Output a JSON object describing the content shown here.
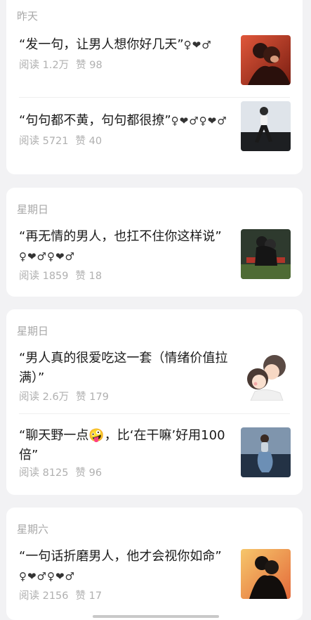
{
  "groups": [
    {
      "date": "昨天",
      "articles": [
        {
          "title": "“发一句，让男人想你好几天”",
          "suffix": "♀❤♂",
          "read": "阅读 1.2万",
          "like": "赞 98",
          "thumb": "couple-red-icon"
        },
        {
          "title": "“句句都不黄，句句都很撩”",
          "suffix": "♀❤♂♀❤♂",
          "read": "阅读 5721",
          "like": "赞 40",
          "thumb": "woman-dance-icon"
        }
      ]
    },
    {
      "date": "星期日",
      "articles": [
        {
          "title": "“再无情的男人，也扛不住你这样说”",
          "suffix": "♀❤♂♀❤♂",
          "read": "阅读 1859",
          "like": "赞 18",
          "thumb": "couple-bench-icon"
        }
      ]
    },
    {
      "date": "星期日",
      "articles": [
        {
          "title": "“男人真的很爱吃这一套（情绪价值拉满）”",
          "suffix": "",
          "read": "阅读 2.6万",
          "like": "赞 179",
          "thumb": "cartoon-couple-icon"
        },
        {
          "title": "“聊天野一点🤪，比‘在干嘛’好用100倍”",
          "suffix": "",
          "read": "阅读 8125",
          "like": "赞 96",
          "thumb": "woman-sitting-icon"
        }
      ]
    },
    {
      "date": "星期六",
      "articles": [
        {
          "title": "“一句话折磨男人，他才会视你如命”",
          "suffix": "♀❤♂♀❤♂",
          "read": "阅读 2156",
          "like": "赞 17",
          "thumb": "couple-sunset-icon"
        }
      ]
    }
  ]
}
